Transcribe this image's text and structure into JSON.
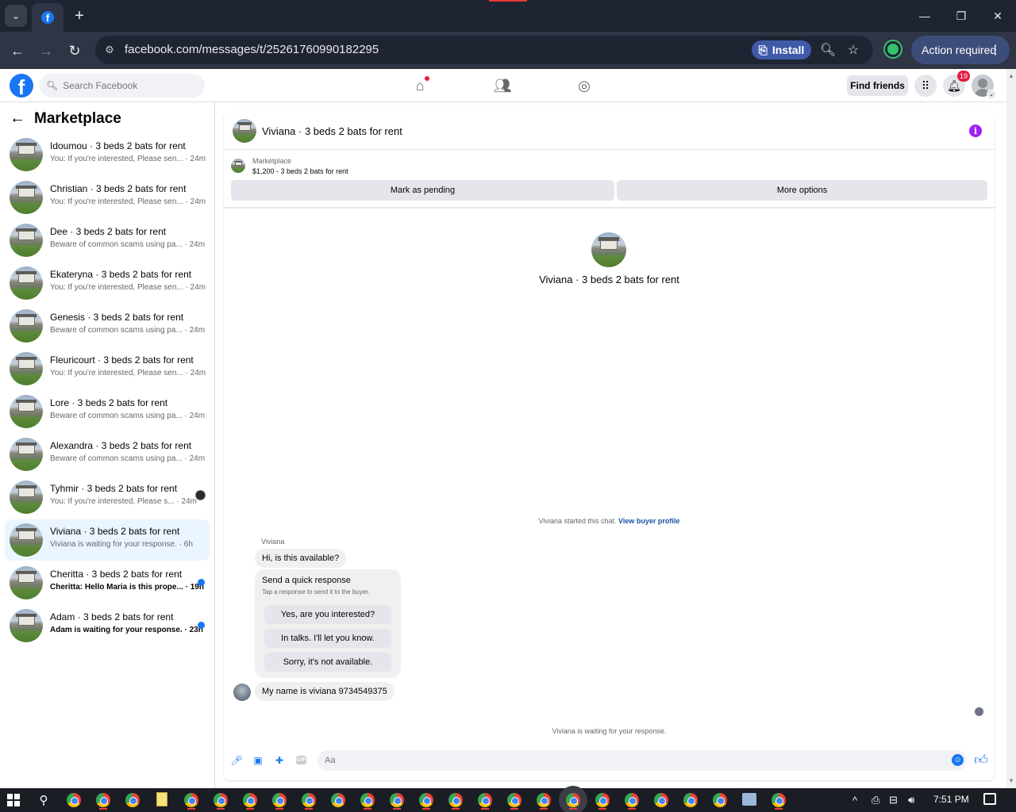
{
  "browser": {
    "url": "facebook.com/messages/t/25261760990182295",
    "install_label": "Install",
    "action_required_label": "Action required"
  },
  "fb_header": {
    "search_placeholder": "Search Facebook",
    "find_friends_label": "Find friends",
    "notification_count": "19"
  },
  "sidebar": {
    "title": "Marketplace",
    "conversations": [
      {
        "title": "Idoumou · 3 beds 2 bats for rent",
        "preview": "You: If you're interested, Please sen... · 24m",
        "unread": false
      },
      {
        "title": "Christian · 3 beds 2 bats for rent",
        "preview": "You: If you're interested, Please sen... · 24m",
        "unread": false
      },
      {
        "title": "Dee · 3 beds 2 bats for rent",
        "preview": "Beware of common scams using pa... · 24m",
        "unread": false
      },
      {
        "title": "Ekateryna · 3 beds 2 bats for rent",
        "preview": "You: If you're interested, Please sen... · 24m",
        "unread": false
      },
      {
        "title": "Genesis · 3 beds 2 bats for rent",
        "preview": "Beware of common scams using pa... · 24m",
        "unread": false
      },
      {
        "title": "Fleuricourt · 3 beds 2 bats for rent",
        "preview": "You: If you're interested, Please sen... · 24m",
        "unread": false
      },
      {
        "title": "Lore · 3 beds 2 bats for rent",
        "preview": "Beware of common scams using pa... · 24m",
        "unread": false
      },
      {
        "title": "Alexandra · 3 beds 2 bats for rent",
        "preview": "Beware of common scams using pa... · 24m",
        "unread": false
      },
      {
        "title": "Tyhmir · 3 beds 2 bats for rent",
        "preview": "You: If you're interested, Please s... · 24m",
        "unread": false
      },
      {
        "title": "Viviana · 3 beds 2 bats for rent",
        "preview": "Viviana is waiting for your response. · 6h",
        "unread": false
      },
      {
        "title": "Cheritta · 3 beds 2 bats for rent",
        "preview": "Cheritta: Hello Maria is this prope... · 19h",
        "unread": true
      },
      {
        "title": "Adam · 3 beds 2 bats for rent",
        "preview": "Adam is waiting for your response. · 23h",
        "unread": true
      }
    ]
  },
  "chat": {
    "title": "Viviana · 3 beds 2 bats for rent",
    "listing_source": "Marketplace",
    "listing_price_title": "$1,200 - 3 beds 2 bats for rent",
    "mark_pending_label": "Mark as pending",
    "more_options_label": "More options",
    "intro_title": "Viviana · 3 beds 2 bats for rent",
    "started_text": "Viviana started this chat.",
    "view_buyer_profile": "View buyer profile",
    "sender_name": "Viviana",
    "first_message": "Hi, is this available?",
    "quick_response_title": "Send a quick response",
    "quick_response_subtitle": "Tap a response to send it to the buyer.",
    "quick_responses": [
      "Yes, are you interested?",
      "In talks. I'll let you know.",
      "Sorry, it's not available."
    ],
    "second_message": "My name is viviana 9734549375",
    "waiting_text": "Viviana is waiting for your response.",
    "composer_placeholder": "Aa"
  },
  "taskbar": {
    "time": "7:51 PM"
  }
}
